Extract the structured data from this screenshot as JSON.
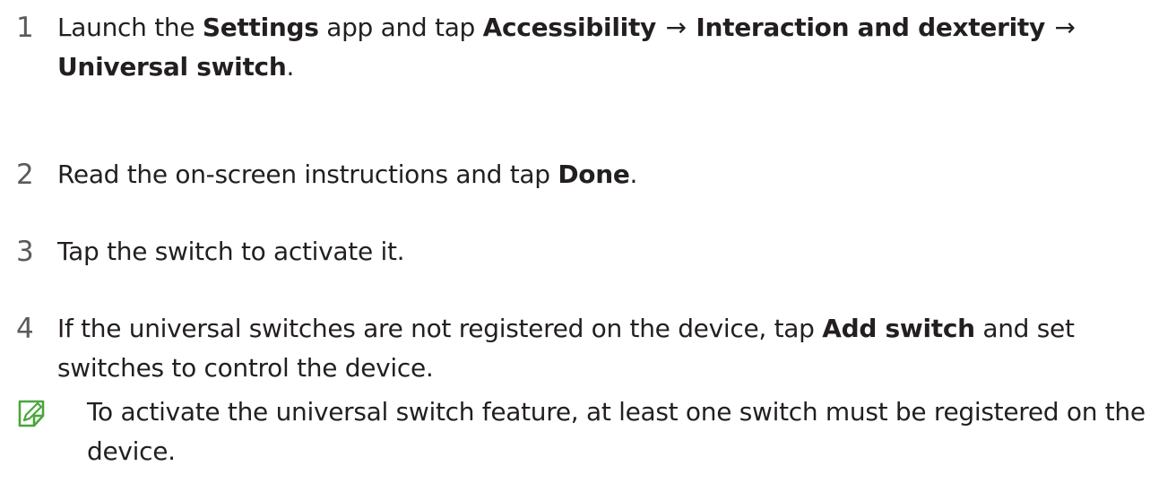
{
  "steps": [
    {
      "number": "1",
      "parts": [
        {
          "text": "Launch the ",
          "bold": false
        },
        {
          "text": "Settings",
          "bold": true
        },
        {
          "text": " app and tap ",
          "bold": false
        },
        {
          "text": "Accessibility",
          "bold": true
        },
        {
          "text": " → ",
          "bold": false
        },
        {
          "text": "Interaction and dexterity",
          "bold": true
        },
        {
          "text": " → ",
          "bold": false
        },
        {
          "text": "Universal switch",
          "bold": true
        },
        {
          "text": ".",
          "bold": false
        }
      ]
    },
    {
      "number": "2",
      "parts": [
        {
          "text": "Read the on-screen instructions and tap ",
          "bold": false
        },
        {
          "text": "Done",
          "bold": true
        },
        {
          "text": ".",
          "bold": false
        }
      ]
    },
    {
      "number": "3",
      "parts": [
        {
          "text": "Tap the switch to activate it.",
          "bold": false
        }
      ]
    },
    {
      "number": "4",
      "parts": [
        {
          "text": "If the universal switches are not registered on the device, tap ",
          "bold": false
        },
        {
          "text": "Add switch",
          "bold": true
        },
        {
          "text": " and set switches to control the device.",
          "bold": false
        }
      ]
    }
  ],
  "note": {
    "icon": "note-pencil-icon",
    "icon_color": "#4aa63c",
    "text": "To activate the universal switch feature, at least one switch must be registered on the device."
  }
}
